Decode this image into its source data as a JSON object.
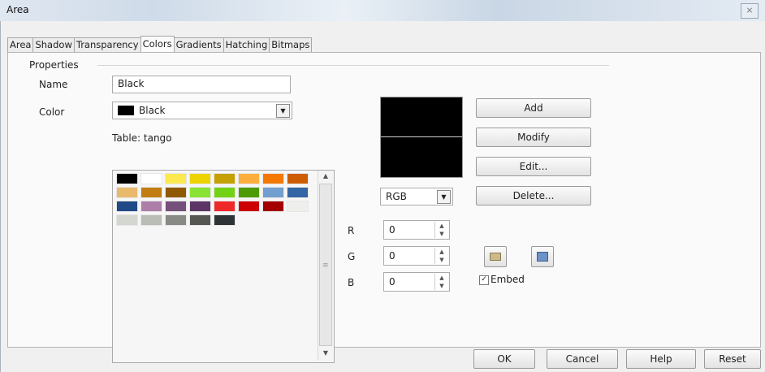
{
  "window": {
    "title": "Area",
    "close_glyph": "⨯"
  },
  "tabs": [
    {
      "label": "Area"
    },
    {
      "label": "Shadow"
    },
    {
      "label": "Transparency"
    },
    {
      "label": "Colors",
      "active": true
    },
    {
      "label": "Gradients"
    },
    {
      "label": "Hatching"
    },
    {
      "label": "Bitmaps"
    }
  ],
  "properties": {
    "group_label": "Properties",
    "name_label": "Name",
    "name_value": "Black",
    "color_label": "Color",
    "color_value": "Black",
    "table_label": "Table: tango"
  },
  "palette": {
    "rows": [
      [
        "#000000",
        "#ffffff",
        "#fce94f",
        "#edd400",
        "#c4a000",
        "#fcaf3e",
        "#f57900",
        "#ce5c00"
      ],
      [
        "#e9b96e",
        "#c17d11",
        "#8f5902",
        "#8ae234",
        "#73d216",
        "#4e9a06",
        "#729fcf",
        "#3465a4"
      ],
      [
        "#204a87",
        "#ad7fa8",
        "#75507b",
        "#5c3566",
        "#ef2929",
        "#cc0000",
        "#a40000",
        "#eeeeec"
      ],
      [
        "#d3d7cf",
        "#babdb6",
        "#888a85",
        "#555753",
        "#2e3436"
      ]
    ]
  },
  "color_model": {
    "value": "RGB"
  },
  "rgb": [
    {
      "label": "R",
      "value": "0"
    },
    {
      "label": "G",
      "value": "0"
    },
    {
      "label": "B",
      "value": "0"
    }
  ],
  "buttons": {
    "add": "Add",
    "modify": "Modify",
    "edit": "Edit...",
    "delete": "Delete..."
  },
  "embed": {
    "label": "Embed",
    "checked": true
  },
  "footer": {
    "ok": "OK",
    "cancel": "Cancel",
    "help": "Help",
    "reset": "Reset"
  },
  "icons": {
    "load_table": "folder-icon",
    "save_table": "save-table-icon",
    "scroll_up": "▲",
    "scroll_down": "▼",
    "combo_arrow": "▼",
    "spin_up": "▲",
    "spin_down": "▼",
    "check": "✓",
    "grip": "≡"
  }
}
